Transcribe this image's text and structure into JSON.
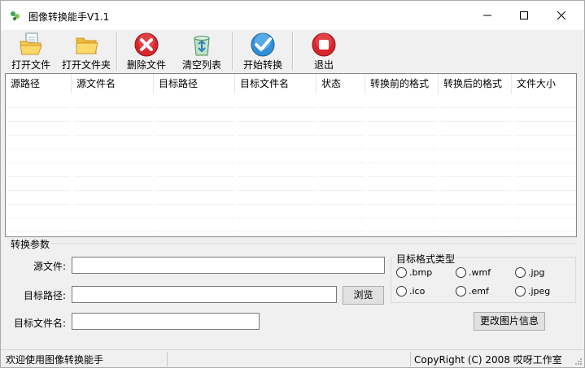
{
  "window": {
    "title": "图像转换能手V1.1"
  },
  "toolbar": {
    "open_file": "打开文件",
    "open_folder": "打开文件夹",
    "delete_file": "删除文件",
    "clear_list": "清空列表",
    "start_convert": "开始转换",
    "exit": "退出"
  },
  "list": {
    "columns": [
      "源路径",
      "源文件名",
      "目标路径",
      "目标文件名",
      "状态",
      "转换前的格式",
      "转换后的格式",
      "文件大小"
    ]
  },
  "params": {
    "group_title": "转换参数",
    "source_label": "源文件:",
    "source_value": "",
    "target_path_label": "目标路径:",
    "target_path_value": "",
    "browse_button": "浏览",
    "target_name_label": "目标文件名:",
    "target_name_value": "",
    "change_info_button": "更改图片信息"
  },
  "format": {
    "title": "目标格式类型",
    "options": [
      ".bmp",
      ".wmf",
      ".jpg",
      ".ico",
      ".emf",
      ".jpeg"
    ]
  },
  "status": {
    "left": "欢迎使用图像转换能手",
    "right": "CopyRight (C) 2008 哎呀工作室"
  },
  "colors": {
    "window_bg": "#f0f0f0",
    "list_bg": "#ffffff",
    "delete_red": "#d9262c",
    "start_blue": "#2f8fd8",
    "exit_red": "#d9262c",
    "folder_yellow": "#f5c94a"
  }
}
